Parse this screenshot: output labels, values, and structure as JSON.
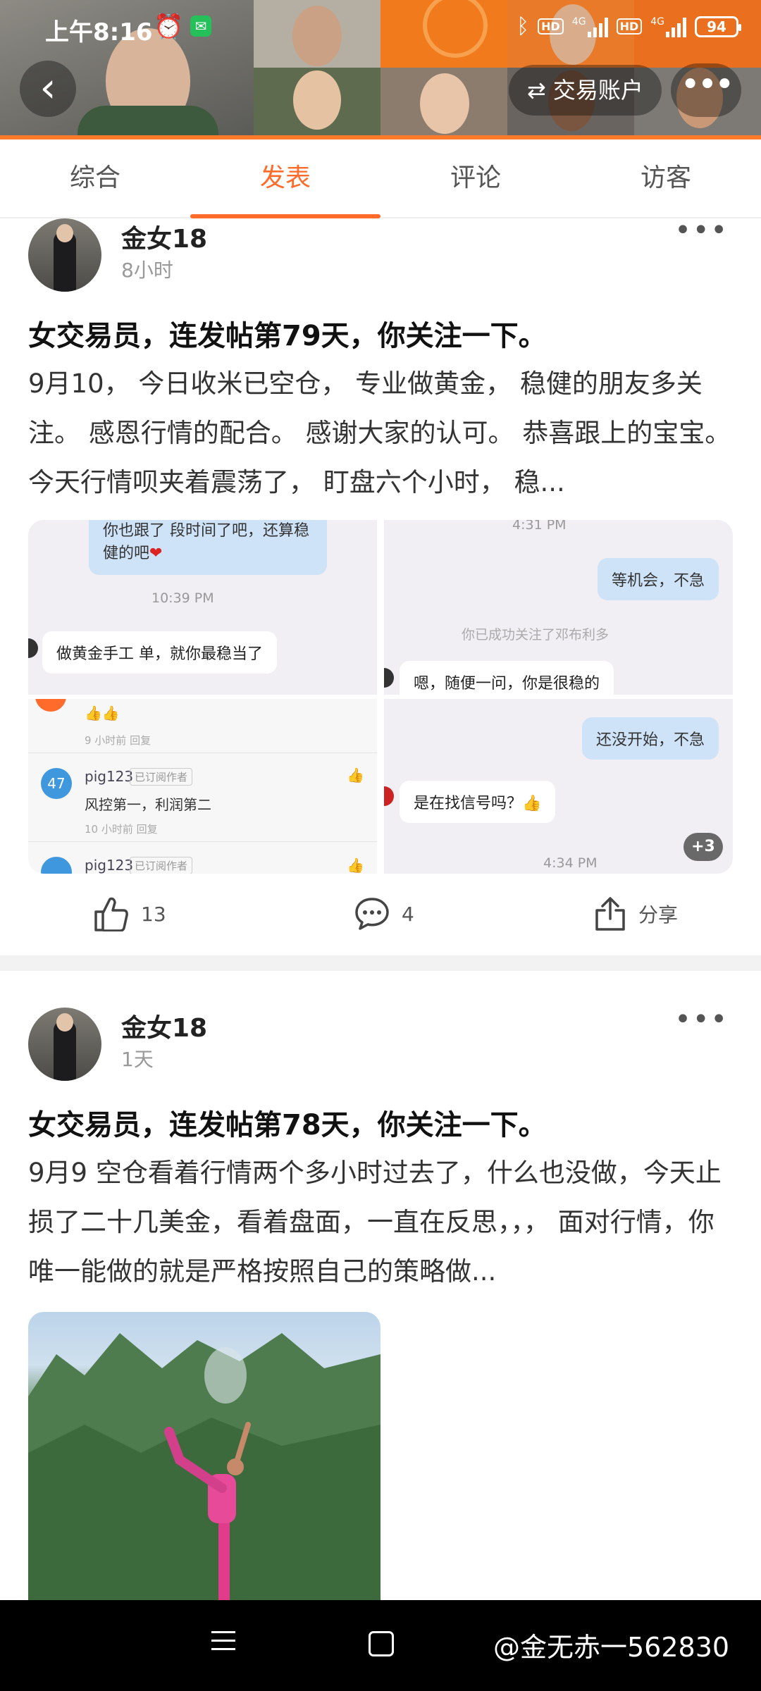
{
  "status_bar": {
    "time": "上午8:16",
    "alarm_icon": "alarm-clock-icon",
    "wechat_icon": "wechat-icon",
    "bluetooth_icon": "bluetooth-icon",
    "network_label_1": "HD",
    "network_type_1": "4G",
    "network_label_2": "HD",
    "network_type_2": "4G",
    "battery": "94"
  },
  "header": {
    "back_icon": "chevron-left-icon",
    "trade_account_label": "交易账户",
    "swap_icon": "swap-arrows-icon",
    "more_icon": "more-dots-icon",
    "accent_color": "#ff6b2b"
  },
  "tabs": [
    {
      "label": "综合",
      "active": false
    },
    {
      "label": "发表",
      "active": true
    },
    {
      "label": "评论",
      "active": false
    },
    {
      "label": "访客",
      "active": false
    }
  ],
  "posts": [
    {
      "author": "金女18",
      "time_ago": "8小时",
      "title": "女交易员，连发帖第79天，你关注一下。",
      "body": "9月10， 今日收米已空仓， 专业做黄金， 稳健的朋友多关注。 感恩行情的配合。 感谢大家的认可。 恭喜跟上的宝宝。 今天行情呗夹着震荡了， 盯盘六个小时， 稳...",
      "images": {
        "img1": {
          "top_bubble": "你也跟了   段时间了吧，还算稳健的吧",
          "heart": "❤",
          "timestamp": "10:39 PM",
          "other_bubble": "做黄金手工 单，就你最稳当了"
        },
        "img2": {
          "timestamp": "4:31 PM",
          "me_bubble": "等机会，不急",
          "system_msg": "你已成功关注了邓布利多",
          "other_bubble": "嗯，随便一问，你是很稳的"
        },
        "img3": {
          "top_emoji": "👍👍",
          "top_meta": "9 小时前   回复",
          "commenter_badge": "47",
          "commenter": "pig123",
          "commenter_tag": "已订阅作者",
          "comment": "风控第一，利润第二",
          "comment_meta": "10 小时前   回复",
          "commenter_2": "pig123",
          "commenter_2_tag": "已订阅作者"
        },
        "img4": {
          "me_bubble": "还没开始，不急",
          "other_bubble": "是在找信号吗？👍",
          "timestamp": "4:34 PM",
          "more_count": "+3"
        }
      },
      "likes": "13",
      "comments": "4",
      "share_label": "分享"
    },
    {
      "author": "金女18",
      "time_ago": "1天",
      "title": "女交易员，连发帖第78天，你关注一下。",
      "body": "9月9 空仓看着行情两个多小时过去了，什么也没做，今天止损了二十几美金，看着盘面，一直在反思，，， 面对行情，你唯一能做的就是严格按照自己的策略做..."
    }
  ],
  "nav_bar": {
    "menu_icon": "menu-lines-icon",
    "home_icon": "home-square-icon",
    "watermark": "@金无赤一562830"
  }
}
